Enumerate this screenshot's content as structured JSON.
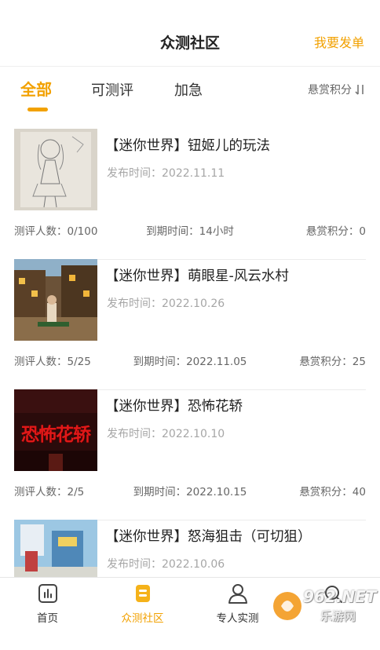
{
  "header": {
    "title": "众测社区",
    "publish_label": "我要发单"
  },
  "tabs": [
    {
      "label": "全部",
      "active": true
    },
    {
      "label": "可测评",
      "active": false
    },
    {
      "label": "加急",
      "active": false
    }
  ],
  "sort": {
    "label": "悬赏积分",
    "icon": "sort-icon"
  },
  "tasks": [
    {
      "title": "【迷你世界】钮姬儿的玩法",
      "date": "发布时间：2022.11.11",
      "reviewers": "测评人数：0/100",
      "deadline": "到期时间：14小时",
      "reward": "悬赏积分：0",
      "thumb": "sketch-drawing"
    },
    {
      "title": "【迷你世界】萌眼星-风云水村",
      "date": "发布时间：2022.10.26",
      "reviewers": "测评人数：5/25",
      "deadline": "到期时间：2022.11.05",
      "reward": "悬赏积分：25",
      "thumb": "village-scene"
    },
    {
      "title": "【迷你世界】恐怖花轿",
      "date": "发布时间：2022.10.10",
      "reviewers": "测评人数：2/5",
      "deadline": "到期时间：2022.10.15",
      "reward": "悬赏积分：40",
      "thumb": "horror-poster",
      "thumb_text": "恐怖花轿"
    },
    {
      "title": "【迷你世界】怒海狙击（可切狙）",
      "date": "发布时间：2022.10.06",
      "thumb": "ship-scene"
    }
  ],
  "nav": [
    {
      "label": "首页",
      "icon": "chart-icon",
      "active": false
    },
    {
      "label": "众测社区",
      "icon": "community-icon",
      "active": true
    },
    {
      "label": "专人实测",
      "icon": "person-icon",
      "active": false
    },
    {
      "label": "",
      "icon": "search-icon",
      "active": false
    }
  ],
  "watermark": {
    "text": "962.NET",
    "subtext": "乐游网"
  },
  "colors": {
    "accent": "#f2a100",
    "text": "#333333",
    "muted": "#a6a6a6"
  }
}
